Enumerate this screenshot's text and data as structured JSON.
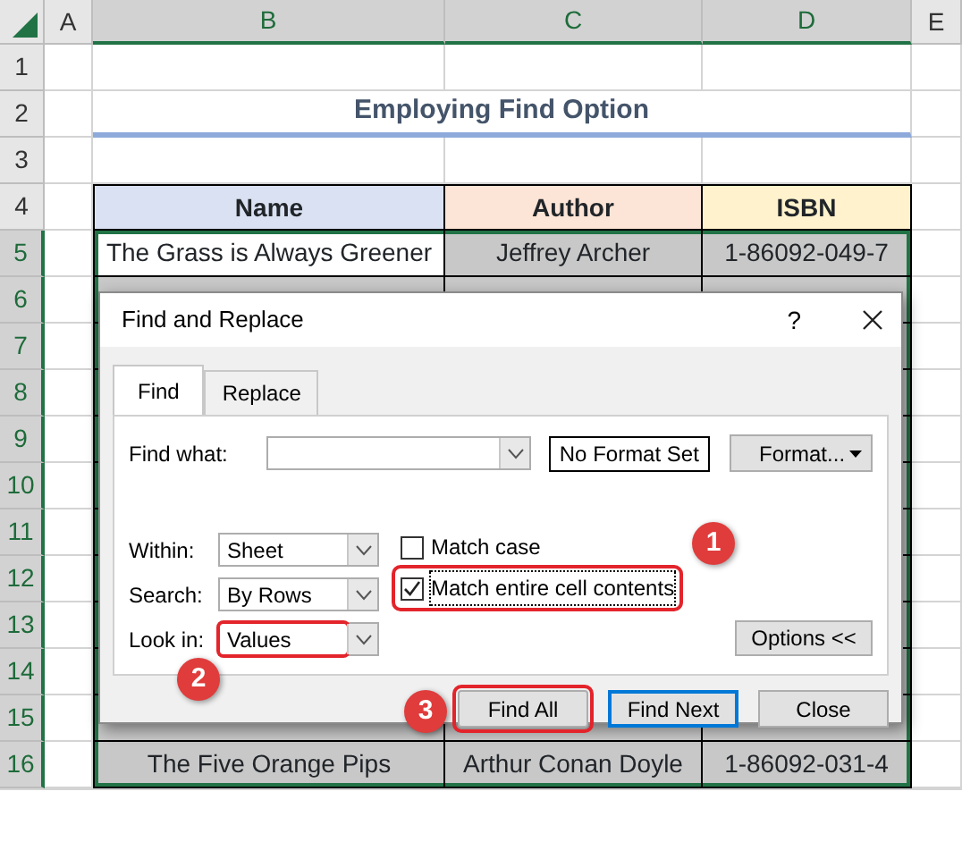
{
  "sheet": {
    "columns": [
      {
        "label": "A",
        "selected": false
      },
      {
        "label": "B",
        "selected": true
      },
      {
        "label": "C",
        "selected": true
      },
      {
        "label": "D",
        "selected": true
      },
      {
        "label": "E",
        "selected": false
      }
    ],
    "rows": [
      {
        "label": "1",
        "selected": false
      },
      {
        "label": "2",
        "selected": false
      },
      {
        "label": "3",
        "selected": false
      },
      {
        "label": "4",
        "selected": false
      },
      {
        "label": "5",
        "selected": true
      },
      {
        "label": "6",
        "selected": true
      },
      {
        "label": "7",
        "selected": true
      },
      {
        "label": "8",
        "selected": true
      },
      {
        "label": "9",
        "selected": true
      },
      {
        "label": "10",
        "selected": true
      },
      {
        "label": "11",
        "selected": true
      },
      {
        "label": "12",
        "selected": true
      },
      {
        "label": "13",
        "selected": true
      },
      {
        "label": "14",
        "selected": true
      },
      {
        "label": "15",
        "selected": true
      },
      {
        "label": "16",
        "selected": true
      }
    ],
    "title": "Employing Find Option",
    "table": {
      "headers": [
        {
          "text": "Name",
          "color": "#d9e1f2"
        },
        {
          "text": "Author",
          "color": "#fce4d6"
        },
        {
          "text": "ISBN",
          "color": "#fff2cc"
        }
      ],
      "selected": true,
      "rows_above_dialog": [
        [
          "The Grass is Always Greener",
          "Jeffrey Archer",
          "1-86092-049-7"
        ]
      ],
      "rows_below_dialog": [
        [
          "The Five Orange Pips",
          "Arthur Conan Doyle",
          "1-86092-031-4"
        ]
      ]
    }
  },
  "dialog": {
    "title": "Find and Replace",
    "help": "?",
    "tabs": [
      {
        "label": "Find",
        "selected": true
      },
      {
        "label": "Replace",
        "selected": false
      }
    ],
    "find_what": {
      "label": "Find what:"
    },
    "format_status": "No Format Set",
    "format_button": "Format...",
    "selects": [
      {
        "label": "Within:",
        "value": "Sheet",
        "highlighted": false
      },
      {
        "label": "Search:",
        "value": "By Rows",
        "highlighted": false
      },
      {
        "label": "Look in:",
        "value": "Values",
        "highlighted": true,
        "callout": "2"
      }
    ],
    "checkboxes": [
      {
        "label": "Match case",
        "checked": false,
        "highlighted": false
      },
      {
        "label": "Match entire cell contents",
        "checked": true,
        "highlighted": true,
        "callout": "1"
      }
    ],
    "options_button": "Options <<",
    "buttons": [
      {
        "label": "Find All",
        "default": false,
        "highlighted": true,
        "callout": "3"
      },
      {
        "label": "Find Next",
        "default": true,
        "highlighted": false
      },
      {
        "label": "Close",
        "default": false,
        "highlighted": false
      }
    ]
  }
}
